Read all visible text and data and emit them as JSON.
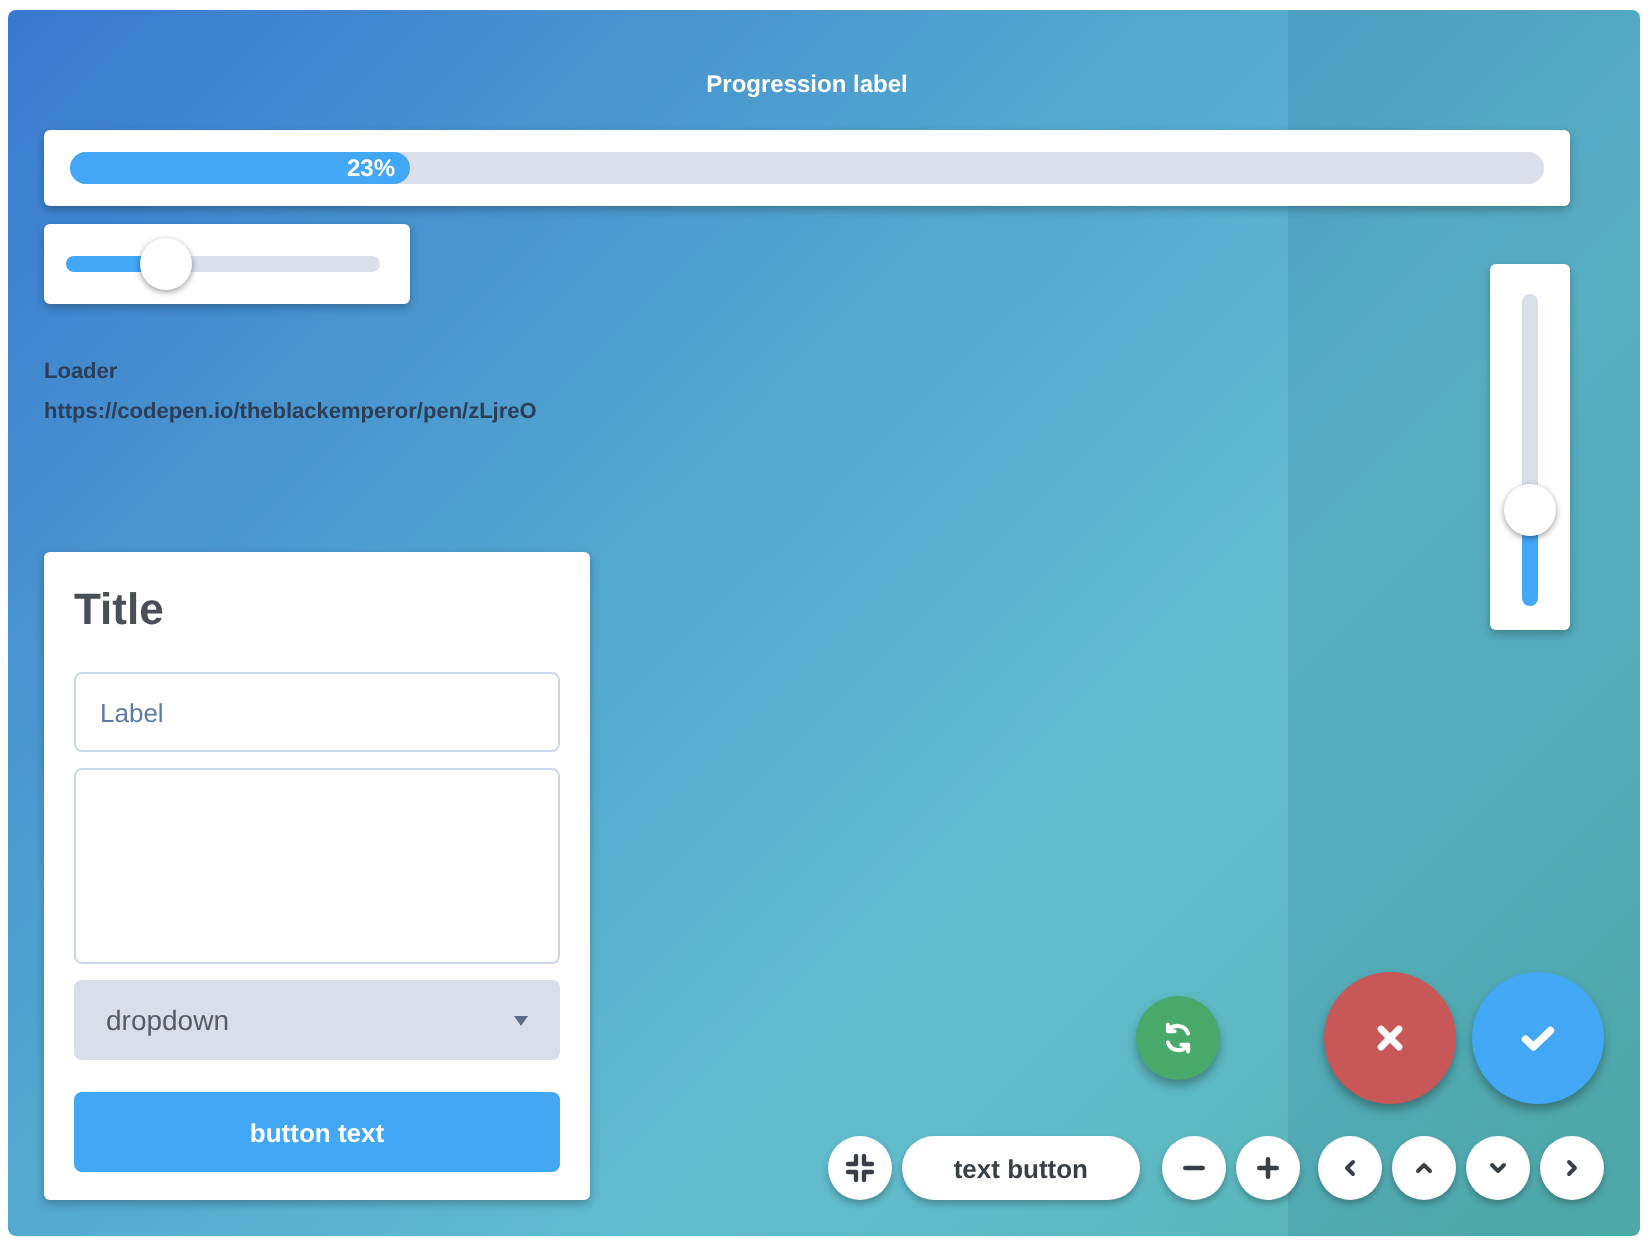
{
  "progress": {
    "label": "Progression label",
    "level": 0.23,
    "reading": "23%"
  },
  "slider": {
    "level": 0.32
  },
  "vertical_slider": {
    "level": 0.31
  },
  "loader": {
    "title": "Loader",
    "link": "https://codepen.io/theblackemperor/pen/zLjreO"
  },
  "form": {
    "title": "Title",
    "input": {
      "placeholder": "Label"
    },
    "dropdown": {
      "value": "dropdown"
    },
    "button": "button text"
  },
  "action_buttons": [
    {
      "kind": "refresh"
    },
    {
      "kind": "cancel"
    },
    {
      "kind": "confirm"
    }
  ],
  "toolbar": [
    {
      "kind": "collapse"
    },
    {
      "kind": "text",
      "label": "text button"
    },
    {
      "kind": "minus"
    },
    {
      "kind": "plus"
    },
    {
      "kind": "left"
    },
    {
      "kind": "up"
    },
    {
      "kind": "down"
    },
    {
      "kind": "right"
    }
  ]
}
